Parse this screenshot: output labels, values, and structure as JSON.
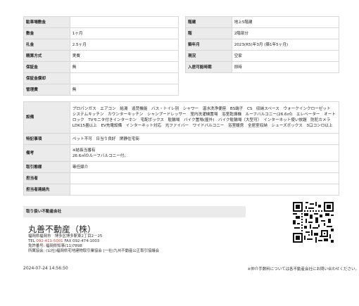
{
  "left_table": [
    {
      "label": "駐車場敷金",
      "value": ""
    },
    {
      "label": "敷金",
      "value": "1ヶ月"
    },
    {
      "label": "礼金",
      "value": "2.5ヶ月"
    },
    {
      "label": "精算方式",
      "value": "実費"
    },
    {
      "label": "保証金",
      "value": "無"
    },
    {
      "label": "保証金償却",
      "value": ""
    },
    {
      "label": "管理費",
      "value": "無"
    }
  ],
  "right_table": [
    {
      "label": "階建",
      "value": "地上5階建"
    },
    {
      "label": "階",
      "value": "2階部分"
    },
    {
      "label": "築年月",
      "value": "2023(R5)年3月 (築1年5ヶ月)"
    },
    {
      "label": "現況",
      "value": "空家"
    },
    {
      "label": "入居可能時期",
      "value": "即時"
    }
  ],
  "bottom_table": [
    {
      "label": "設備",
      "value": "プロパンガス　エアコン　給湯　追焚機能　バス・トイレ別　シャワー　温水洗浄便座　BS端子　CS　収納スペース　ウォークインクローゼット　システムキッチン　カウンターキッチン　シャンプードレッサー　室内洗濯機置場　浴室乾燥機　ルーフバルコニー(26.6㎡)　エレベーター　オートロック　TVモニタ付きインターホン　宅配ボックス　駐輪場　バイク置場(屋外)　バイク駐輪場（大型可）　インターネット使い放題　防犯カメラ　LDK15畳以上　EV充電設備　インターネット対応　光ファイバー　ワイドバルコニー　浴室暖房　全居室収納　シューズボックス　3口コンロ以上"
    },
    {
      "label": "特記事項",
      "value": "ペット不可　日当り良好　閑静住宅街"
    },
    {
      "label": "備考",
      "value": "※結長当番有\n26.6㎡のルーフバルコニー付。"
    },
    {
      "label": "取引態様",
      "value": "専任媒介"
    },
    {
      "label": "担当者",
      "value": ""
    },
    {
      "label": "担当者連絡先",
      "value": ""
    }
  ],
  "agent": {
    "section_title": "取り扱い不動産会社",
    "company_name": "丸善不動産（株）",
    "address": "福岡県福岡市　博多区博多駅東2丁目2－25",
    "tel_label": "TEL ",
    "tel": "092-411-5001",
    "fax": " FAX 092-474-1003",
    "license": "免許番号: 福岡県知事(11)7898",
    "association": "所属協会: (公社)福岡県宅地建物取引業協会 (一社)九州不動産公正取引協議会"
  },
  "footer": {
    "timestamp": "2024-07-24 14:56:50",
    "note": "※仲介手数料については各不動産会社にお問い合わせください。"
  }
}
